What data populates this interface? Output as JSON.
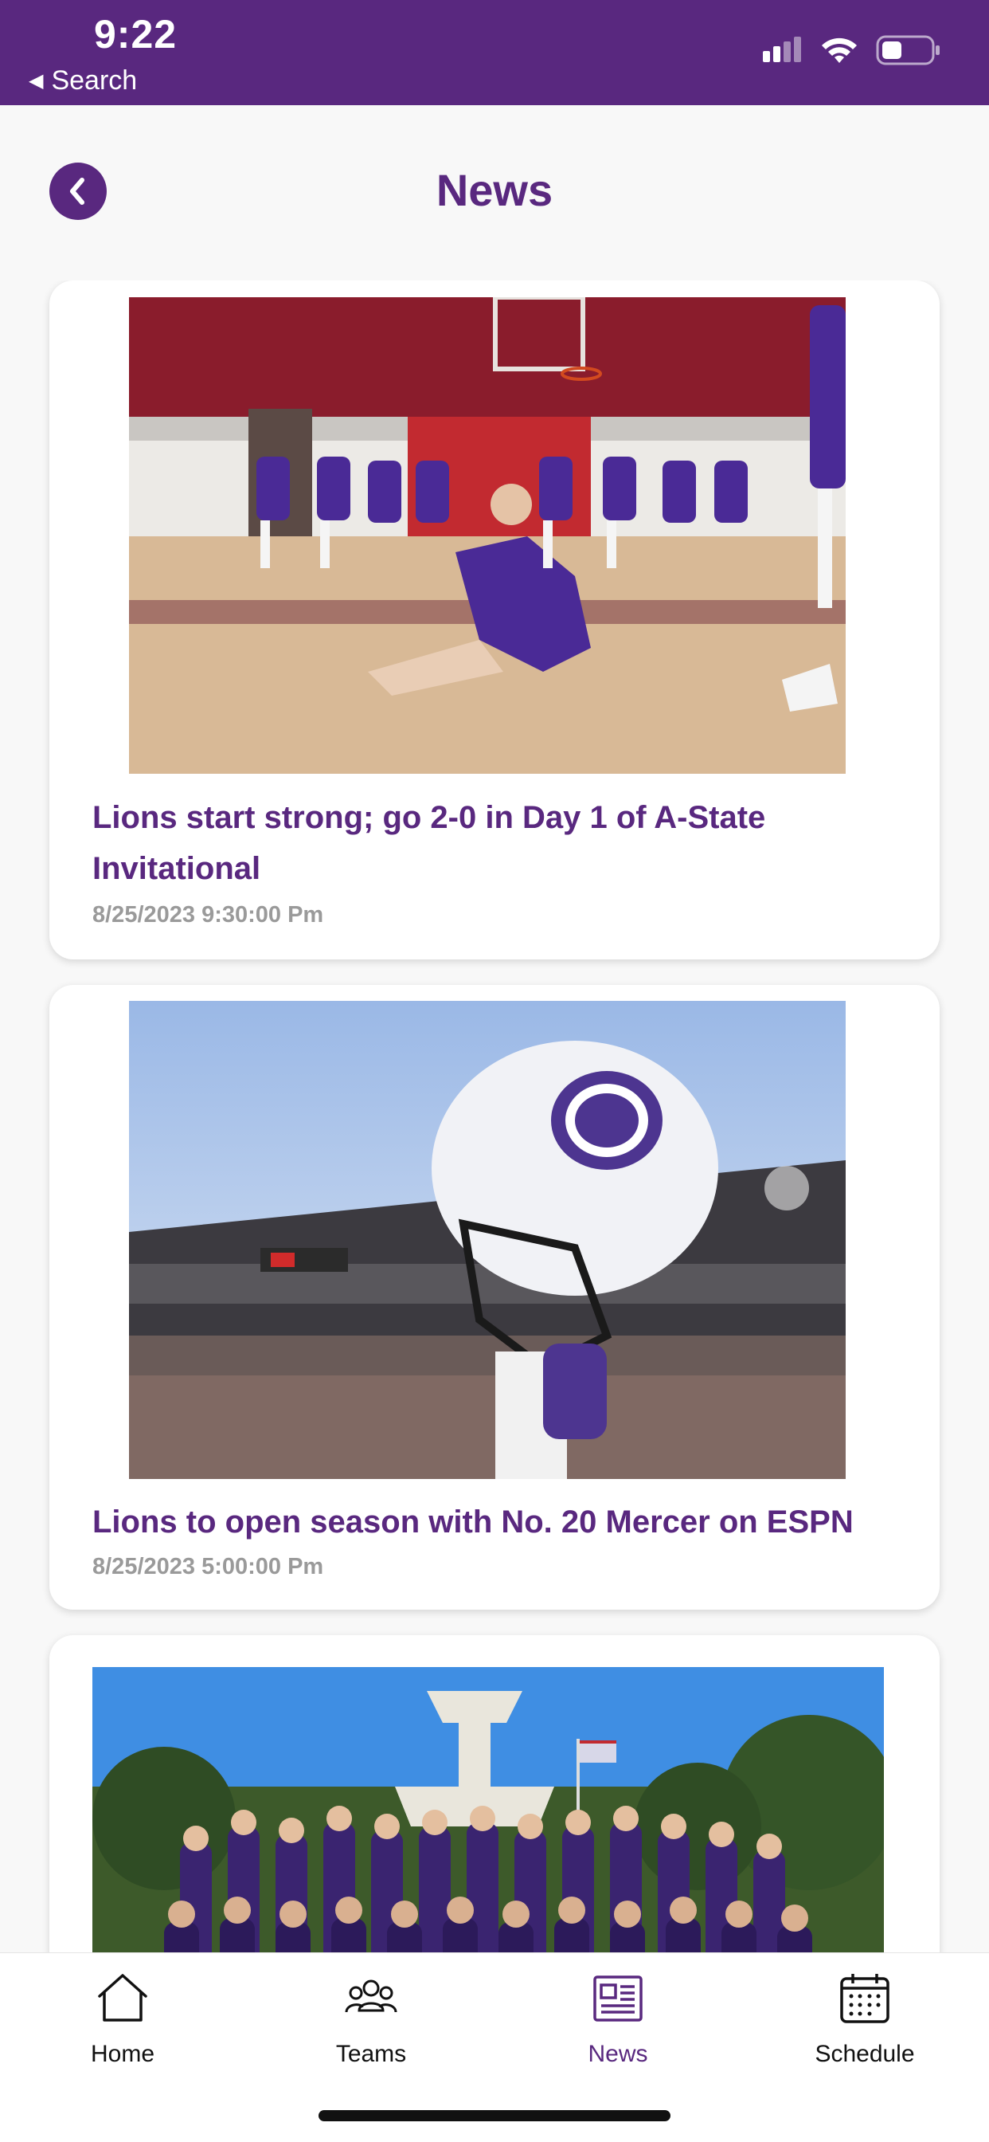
{
  "status_bar": {
    "time": "9:22",
    "back_label": "Search",
    "icons": [
      "signal-icon",
      "wifi-icon",
      "battery-icon"
    ]
  },
  "header": {
    "title": "News",
    "back_icon": "chevron-left-icon"
  },
  "news": [
    {
      "title": "Lions start strong; go 2-0 in Day 1 of A-State Invitational",
      "date": "8/25/2023 9:30:00 Pm",
      "image_subject": "volleyball"
    },
    {
      "title": "Lions to open season with No. 20 Mercer on ESPN",
      "date": "8/25/2023 5:00:00 Pm",
      "image_subject": "football-helmet"
    },
    {
      "title": "",
      "date": "",
      "image_subject": "team-photo"
    }
  ],
  "tabs": [
    {
      "label": "Home",
      "icon": "home-icon",
      "active": false
    },
    {
      "label": "Teams",
      "icon": "teams-icon",
      "active": false
    },
    {
      "label": "News",
      "icon": "news-icon",
      "active": true
    },
    {
      "label": "Schedule",
      "icon": "calendar-icon",
      "active": false
    }
  ],
  "colors": {
    "brand": "#59287f",
    "background": "#f8f8f8",
    "date": "#9a9a9a"
  }
}
